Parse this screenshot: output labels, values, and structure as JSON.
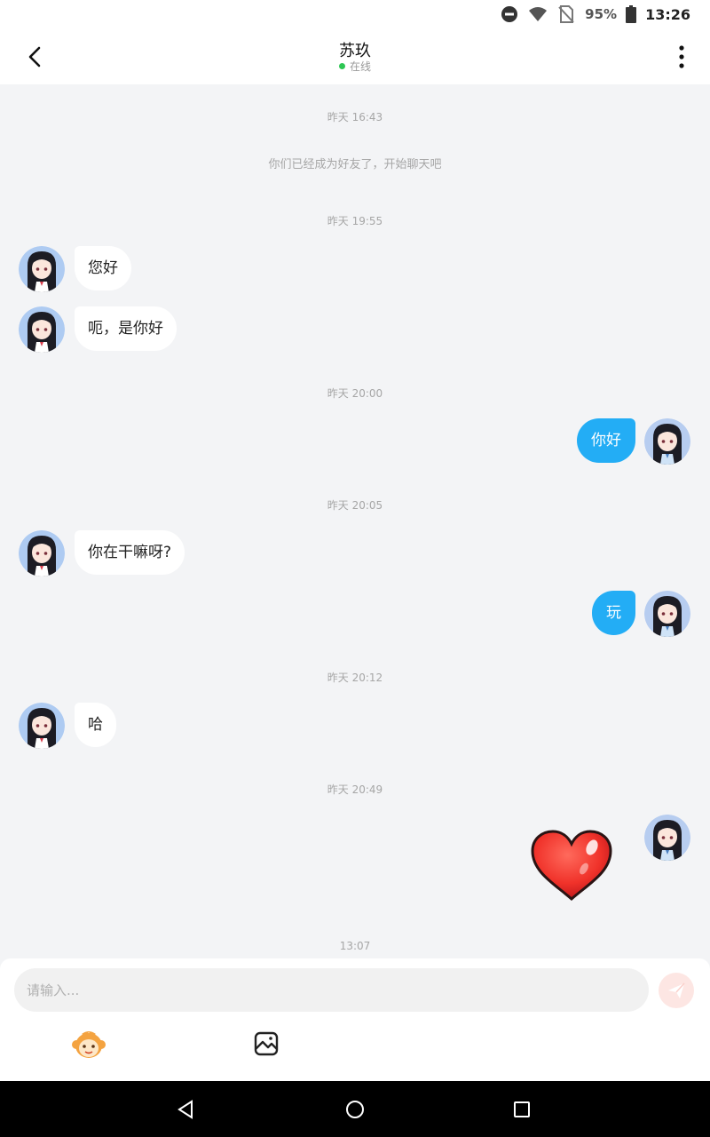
{
  "status_bar": {
    "battery": "95%",
    "time": "13:26"
  },
  "header": {
    "title": "苏玖",
    "status": "在线"
  },
  "chat": {
    "timestamps": [
      "昨天 16:43",
      "昨天 19:55",
      "昨天 20:00",
      "昨天 20:05",
      "昨天 20:12",
      "昨天 20:49",
      "13:07"
    ],
    "system_message": "你们已经成为好友了，开始聊天吧",
    "messages": [
      {
        "side": "in",
        "text": "您好"
      },
      {
        "side": "in",
        "text": "呃，是你好"
      },
      {
        "side": "out",
        "text": "你好"
      },
      {
        "side": "in",
        "text": "你在干嘛呀?"
      },
      {
        "side": "out",
        "text": "玩"
      },
      {
        "side": "in",
        "text": "哈"
      },
      {
        "side": "out",
        "sticker": "heart-sticker"
      }
    ]
  },
  "composer": {
    "placeholder": "请输入..."
  },
  "colors": {
    "outgoing_bubble": "#23adf5",
    "incoming_bubble": "#ffffff",
    "online_dot": "#2dc653",
    "send_button": "#fde6e3"
  }
}
